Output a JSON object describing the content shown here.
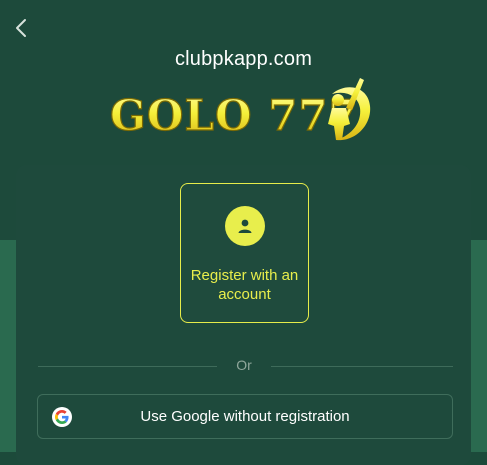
{
  "header": {
    "site_url": "clubpkapp.com"
  },
  "logo": {
    "text": "GOLO 777"
  },
  "register": {
    "label": "Register with an account"
  },
  "divider": {
    "text": "Or"
  },
  "google": {
    "label": "Use Google without registration"
  },
  "colors": {
    "accent": "#e8ee4c",
    "background": "#1d4a3b",
    "page_bottom": "#2a6a4f"
  },
  "icons": {
    "back": "chevron-left-icon",
    "user": "user-icon",
    "google": "google-icon",
    "cricket": "cricket-batsman-icon"
  }
}
